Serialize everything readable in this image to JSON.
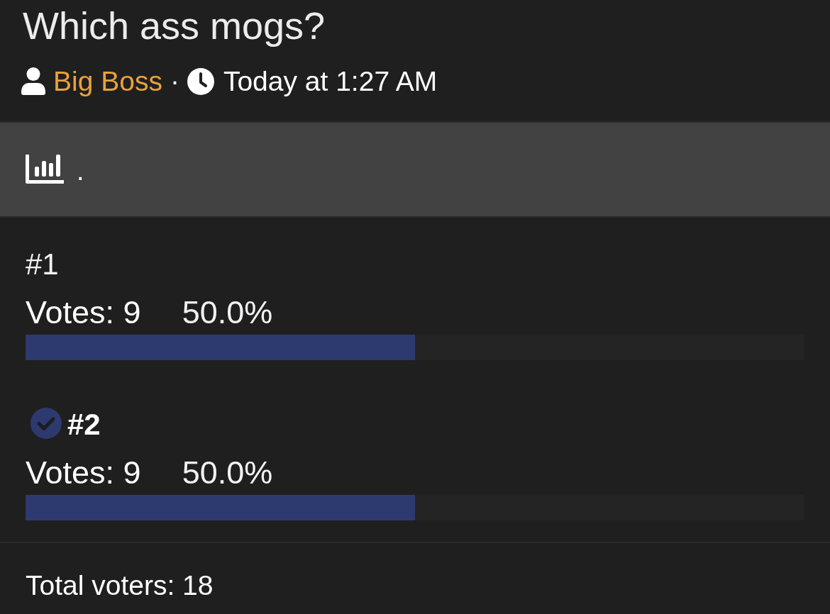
{
  "thread": {
    "title": "Which ass mogs?",
    "author": "Big Boss",
    "separator": "·",
    "timestamp": "Today at 1:27 AM"
  },
  "poll": {
    "question": ".",
    "options": [
      {
        "label": "#1",
        "selected": false,
        "votes": "Votes: 9",
        "percent": "50.0%",
        "level": 0.5
      },
      {
        "label": "#2",
        "selected": true,
        "votes": "Votes: 9",
        "percent": "50.0%",
        "level": 0.5
      }
    ],
    "total": "Total voters: 18"
  }
}
